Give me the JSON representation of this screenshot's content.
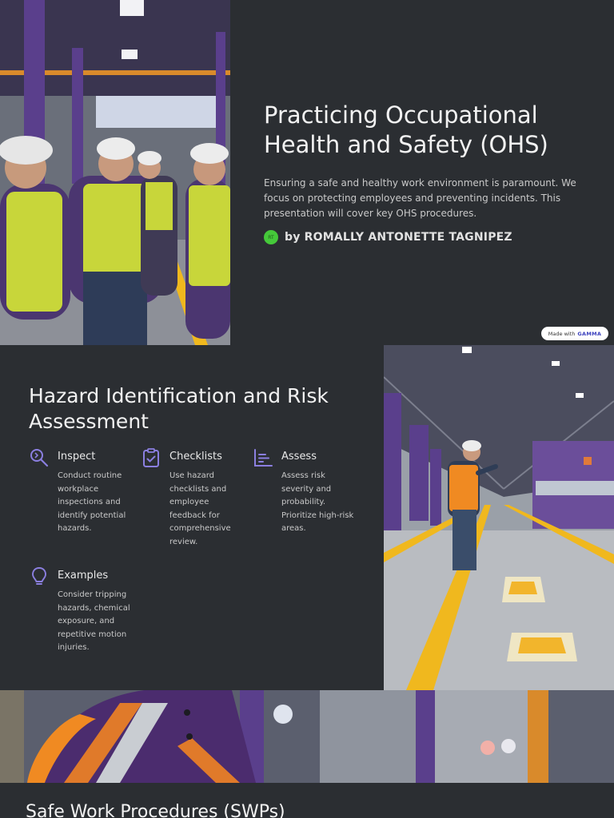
{
  "slide1": {
    "title": "Practicing Occupational Health and Safety (OHS)",
    "description": "Ensuring a safe and healthy work environment is paramount. We focus on protecting employees and preventing incidents. This presentation will cover key OHS procedures.",
    "author_avatar": "RT",
    "author": "by ROMALLY ANTONETTE TAGNIPEZ",
    "badge_prefix": "Made with",
    "badge_brand": "GAMMA"
  },
  "slide2": {
    "title": "Hazard Identification and Risk Assessment",
    "items": [
      {
        "icon": "inspect-icon",
        "title": "Inspect",
        "text": "Conduct routine workplace inspections and identify potential hazards."
      },
      {
        "icon": "clipboard-check-icon",
        "title": "Checklists",
        "text": "Use hazard checklists and employee feedback for comprehensive review."
      },
      {
        "icon": "chart-icon",
        "title": "Assess",
        "text": "Assess risk severity and probability. Prioritize high-risk areas."
      },
      {
        "icon": "lightbulb-icon",
        "title": "Examples",
        "text": "Consider tripping hazards, chemical exposure, and repetitive motion injuries."
      }
    ]
  },
  "slide3": {
    "title": "Safe Work Procedures (SWPs)"
  },
  "colors": {
    "background": "#2b2e32",
    "icon_accent": "#8b7fe0",
    "avatar": "#45c93a",
    "vest_yellow": "#c8d63a",
    "safety_line": "#f0b81e",
    "factory_purple": "#5a3f8c"
  }
}
